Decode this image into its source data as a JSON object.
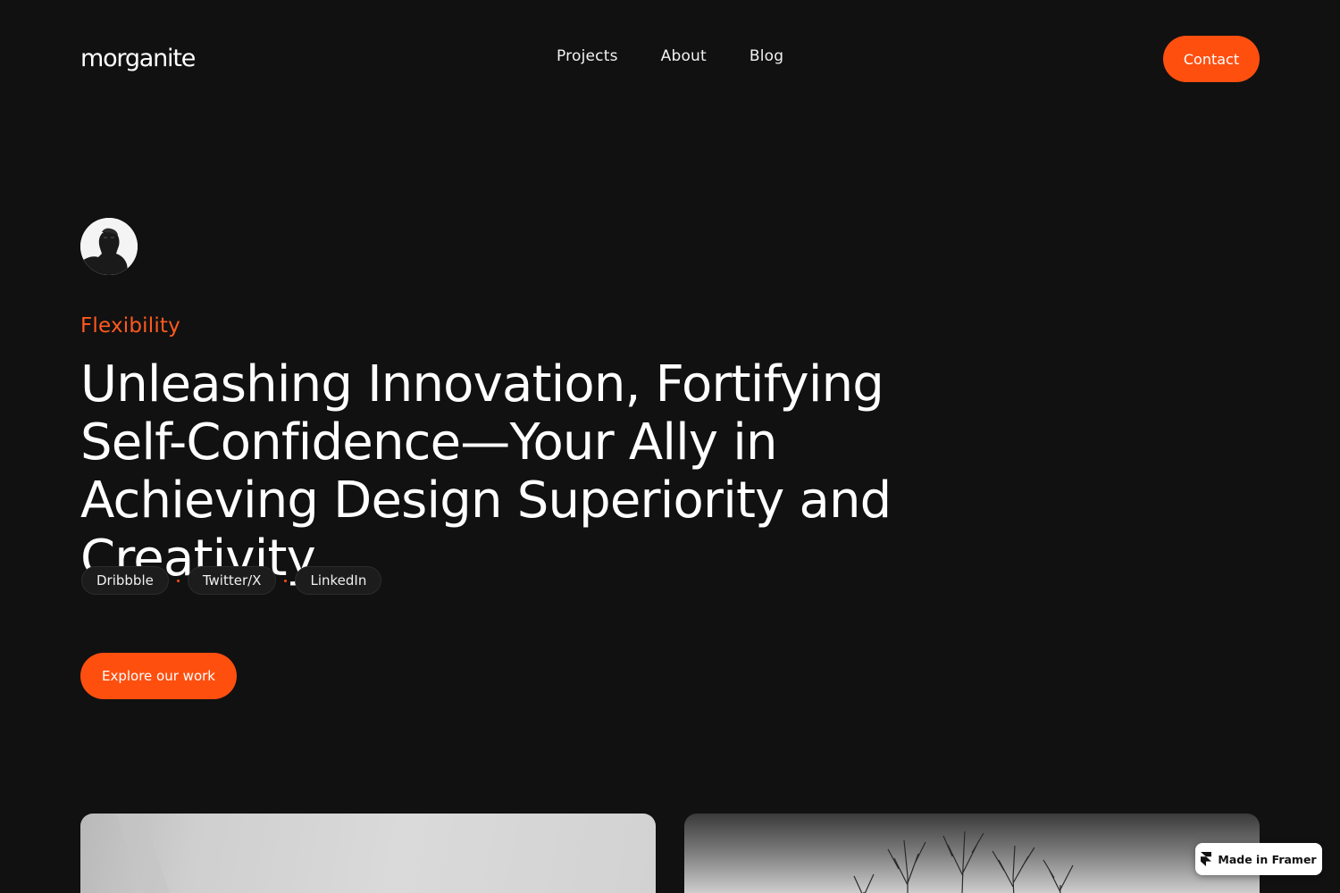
{
  "header": {
    "logo": "morganite",
    "nav": [
      "Projects",
      "About",
      "Blog"
    ],
    "contact_label": "Contact"
  },
  "hero": {
    "eyebrow": "Flexibility",
    "headline": "Unleashing Innovation, Fortifying Self-Confidence—Your Ally in Achieving Design Superiority and Creativity.",
    "socials": [
      "Dribbble",
      "Twitter/X",
      "LinkedIn"
    ],
    "cta_label": "Explore our work"
  },
  "badge": {
    "label": "Made in Framer",
    "icon": "framer-logo-icon"
  },
  "colors": {
    "background": "#111111",
    "accent": "#ff4f0f",
    "text": "#ffffff"
  }
}
